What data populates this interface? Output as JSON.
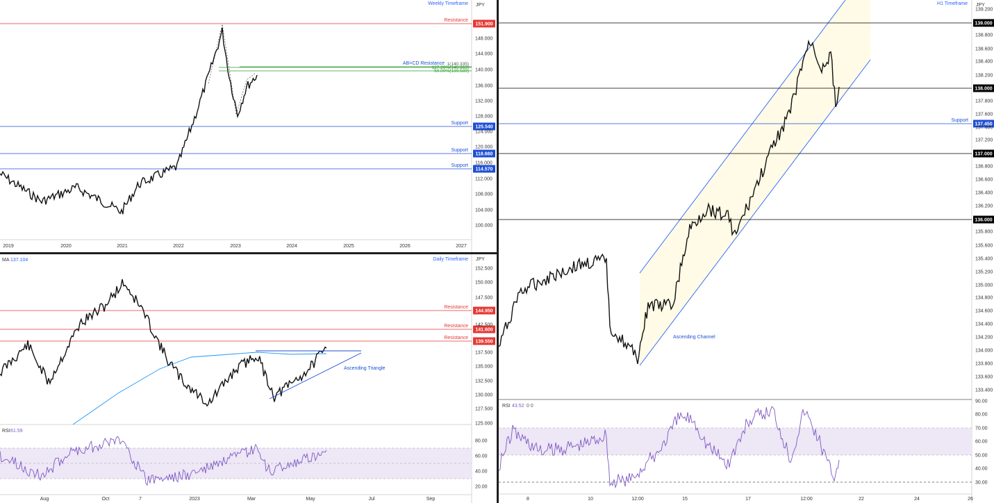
{
  "panels": {
    "weekly": {
      "timeframe_label": "Weekly Timeframe",
      "currency": "JPY",
      "price_ticks": [
        "148.000",
        "144.000",
        "140.000",
        "136.000",
        "132.000",
        "128.000",
        "124.000",
        "120.000",
        "116.000",
        "112.000",
        "108.000",
        "104.000",
        "100.000"
      ],
      "time_ticks": [
        "2019",
        "2020",
        "2021",
        "2022",
        "2023",
        "2024",
        "2025",
        "2026",
        "2027"
      ],
      "levels": [
        {
          "label": "Resistance",
          "value": "151.900",
          "color": "#e53935"
        },
        {
          "label": "Support",
          "value": "125.540",
          "color": "#1e4fd6"
        },
        {
          "label": "Support",
          "value": "118.660",
          "color": "#1e4fd6"
        },
        {
          "label": "Support",
          "value": "114.570",
          "color": "#1e4fd6"
        }
      ],
      "abcd_label": "AB=CD Resistance",
      "fib_labels": [
        "1(140.335)",
        "127.20%(140.363)",
        "50.00%(139.589)"
      ]
    },
    "daily": {
      "timeframe_label": "Daily Timeframe",
      "currency": "JPY",
      "ma_label": "MA",
      "ma_value": "137.104",
      "price_ticks": [
        "152.500",
        "150.000",
        "147.500",
        "142.500",
        "137.500",
        "135.000",
        "132.500",
        "130.000",
        "127.500",
        "125.000"
      ],
      "time_ticks": [
        "Aug",
        "Oct",
        "7",
        "2023",
        "Mar",
        "May",
        "Jul",
        "Sep"
      ],
      "levels": [
        {
          "label": "Resistance",
          "value": "144.950",
          "color": "#e53935"
        },
        {
          "label": "Resistance",
          "value": "141.600",
          "color": "#e53935"
        },
        {
          "label": "Resistance",
          "value": "139.550",
          "color": "#e53935"
        }
      ],
      "pattern_label": "Ascending Triangle",
      "rsi_label": "RSI",
      "rsi_value": "61.59",
      "rsi_ticks": [
        "80.00",
        "60.00",
        "40.00",
        "20.00"
      ]
    },
    "h1": {
      "timeframe_label": "H1 Timeframe",
      "currency": "JPY",
      "price_ticks": [
        "139.200",
        "138.800",
        "138.600",
        "138.400",
        "138.200",
        "137.800",
        "137.600",
        "137.400",
        "137.200",
        "136.800",
        "136.600",
        "136.400",
        "136.200",
        "135.800",
        "135.600",
        "135.400",
        "135.200",
        "135.000",
        "134.800",
        "134.600",
        "134.400",
        "134.200",
        "134.000",
        "133.800",
        "133.600",
        "133.400"
      ],
      "time_ticks": [
        "8",
        "10",
        "12:00",
        "15",
        "17",
        "12:00",
        "22",
        "24",
        "26"
      ],
      "levels": [
        {
          "label": "",
          "value": "139.000",
          "color": "#000000"
        },
        {
          "label": "",
          "value": "138.000",
          "color": "#000000"
        },
        {
          "label": "Support",
          "value": "137.450",
          "color": "#1e4fd6"
        },
        {
          "label": "",
          "value": "137.000",
          "color": "#000000"
        },
        {
          "label": "",
          "value": "136.000",
          "color": "#000000"
        }
      ],
      "pattern_label": "Ascending Channel",
      "rsi_label": "RSI",
      "rsi_value": "43.52",
      "rsi_extra": "0  0",
      "rsi_ticks": [
        "90.00",
        "80.00",
        "70.00",
        "60.00",
        "50.00",
        "40.00",
        "30.00"
      ]
    }
  },
  "chart_data": [
    {
      "type": "candlestick",
      "title": "Weekly Timeframe",
      "ylabel": "JPY",
      "ylim": [
        97,
        154
      ],
      "x": [
        "2019",
        "2020",
        "2021",
        "2022",
        "2023"
      ],
      "series": [
        {
          "values": [
            110,
            109,
            105,
            115,
            150,
            131,
            138
          ]
        }
      ],
      "annotations": [
        "Resistance 151.900",
        "Support 125.540",
        "Support 118.660",
        "Support 114.570",
        "AB=CD Resistance"
      ]
    },
    {
      "type": "candlestick",
      "title": "Daily Timeframe",
      "ylabel": "JPY",
      "ylim": [
        124,
        154
      ],
      "series": [
        {
          "values": [
            136,
            133,
            144,
            151,
            138,
            128,
            138,
            130,
            139
          ]
        }
      ],
      "annotations": [
        "Resistance 144.950",
        "Resistance 141.600",
        "Resistance 139.550",
        "Ascending Triangle"
      ]
    },
    {
      "type": "candlestick",
      "title": "H1 Timeframe",
      "ylabel": "JPY",
      "ylim": [
        133.3,
        139.35
      ],
      "series": [
        {
          "values": [
            134.0,
            135.4,
            133.85,
            136.2,
            135.7,
            137.6,
            138.7,
            137.7,
            137.9
          ]
        }
      ],
      "annotations": [
        "Support 137.450",
        "Ascending Channel"
      ]
    }
  ]
}
